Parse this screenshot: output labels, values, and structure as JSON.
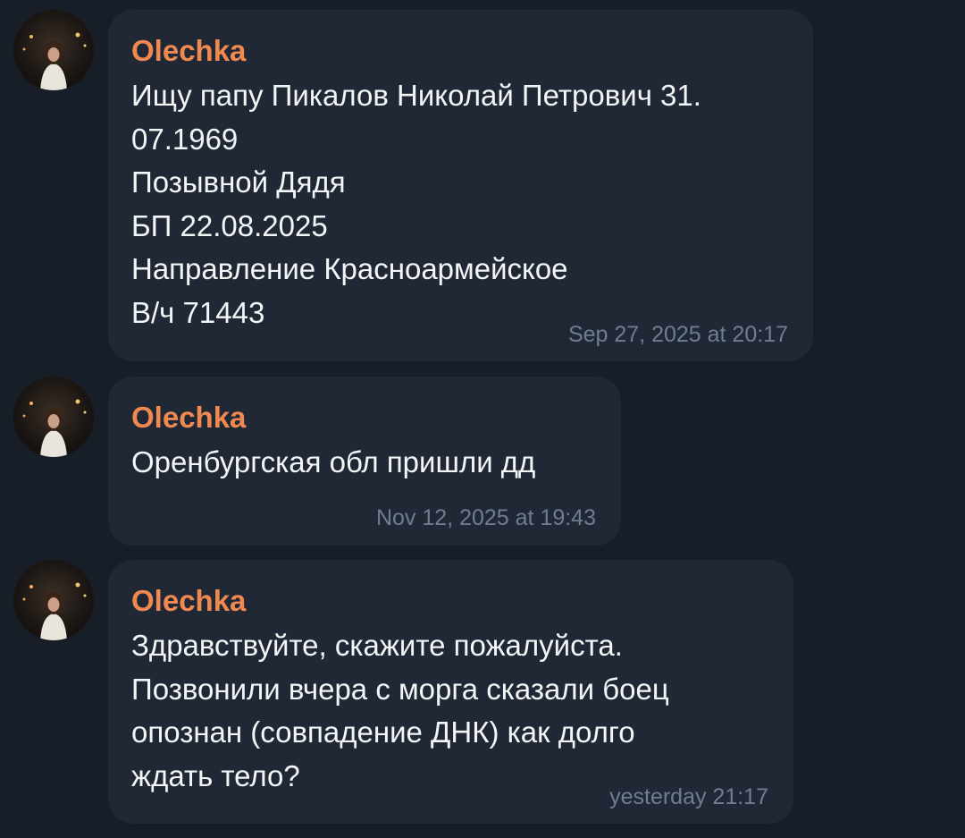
{
  "messages": [
    {
      "sender": "Olechka",
      "text": "Ищу папу Пикалов Николай Петрович 31.\n07.1969\nПозывной Дядя\nБП 22.08.2025\nНаправление Красноармейское\nВ/ч 71443",
      "time": "Sep 27, 2025 at 20:17"
    },
    {
      "sender": "Olechka",
      "text": "Оренбургская обл пришли дд",
      "time": "Nov 12, 2025 at 19:43"
    },
    {
      "sender": "Olechka",
      "text": "Здравствуйте, скажите пожалуйста.\nПозвонили вчера с морга сказали боец\nопознан (совпадение ДНК) как долго\nждать тело?",
      "time": "yesterday 21:17"
    }
  ],
  "colors": {
    "background": "#171e28",
    "bubble": "#202836",
    "sender_name": "#f0894f",
    "message_text": "#f3f5f7",
    "timestamp": "#6f7d8e"
  }
}
